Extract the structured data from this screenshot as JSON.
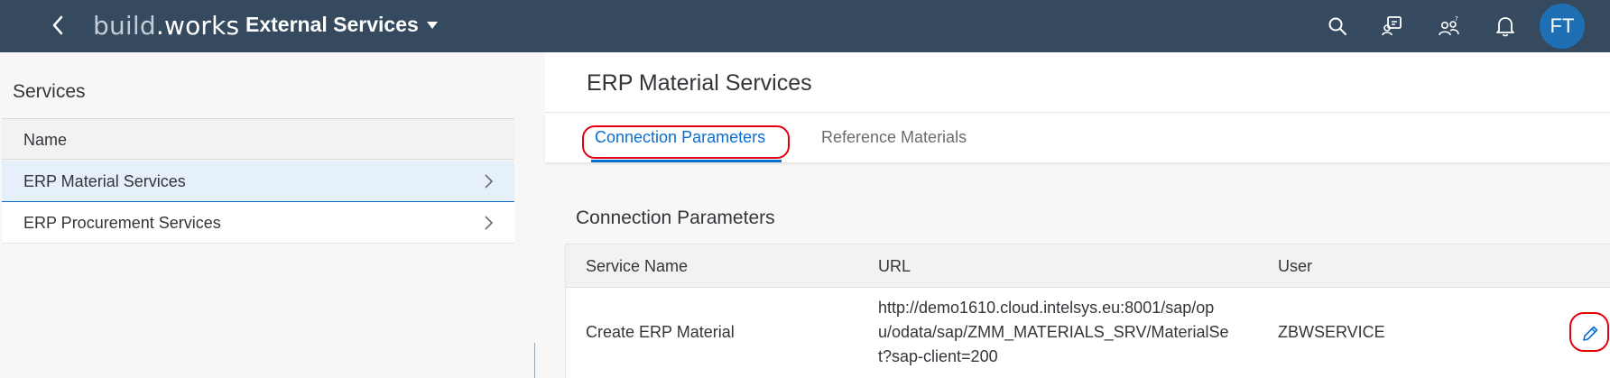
{
  "shell": {
    "logo_part1": "build",
    "logo_dot": ".",
    "logo_part2": "works",
    "app_title": "External Services",
    "avatar_initials": "FT",
    "colors": {
      "shell_bg": "#354a5f",
      "avatar_bg": "#1f6fb5",
      "accent": "#0a6ed1",
      "highlight": "#e3000f"
    },
    "icons": [
      "back-icon",
      "search-icon",
      "products-icon",
      "users-icon",
      "notification-icon"
    ]
  },
  "master": {
    "title": "Services",
    "column_header": "Name",
    "items": [
      {
        "label": "ERP Material Services",
        "selected": true
      },
      {
        "label": "ERP Procurement Services",
        "selected": false
      }
    ]
  },
  "detail": {
    "title": "ERP Material Services",
    "tabs": [
      {
        "label": "Connection Parameters",
        "active": true
      },
      {
        "label": "Reference Materials",
        "active": false
      }
    ],
    "section_title": "Connection Parameters",
    "table": {
      "columns": [
        "Service Name",
        "URL",
        "User"
      ],
      "rows": [
        {
          "service_name": "Create ERP Material",
          "url": "http://demo1610.cloud.intelsys.eu:8001/sap/opu/odata/sap/ZMM_MATERIALS_SRV/MaterialSet?sap-client=200",
          "url_line1": "http://demo1610.cloud.intelsys.eu:8001/sap/op",
          "url_line2": "u/odata/sap/ZMM_MATERIALS_SRV/MaterialSe",
          "url_line3": "t?sap-client=200",
          "user": "ZBWSERVICE"
        }
      ]
    }
  }
}
